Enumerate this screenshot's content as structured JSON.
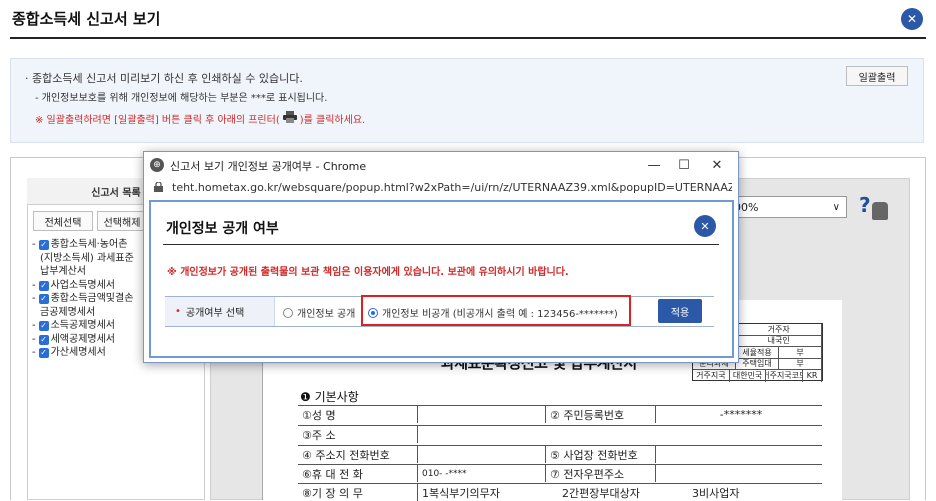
{
  "header": {
    "title": "종합소득세 신고서 보기",
    "close_label": "✕"
  },
  "info": {
    "line1": "· 종합소득세 신고서 미리보기 하신 후 인쇄하실 수 있습니다.",
    "line2": "- 개인정보보호를 위해 개인정보에 해당하는 부분은  ***로 표시됩니다.",
    "line3_before": "※ 일괄출력하려면 [일괄출력] 버튼 클릭 후 아래의 프린터(",
    "line3_after": ")를 클릭하세요.",
    "bulk_print_label": "일괄출력"
  },
  "left_pane": {
    "heading": "신고서 목록",
    "select_all_label": "전체선택",
    "deselect_label": "선택해제",
    "tree": [
      {
        "label": "종합소득세·농어촌",
        "checked": true
      },
      {
        "label": "(지방소득세) 과세표준",
        "checked": false,
        "indent": true
      },
      {
        "label": "납부계산서",
        "checked": false,
        "indent": true
      },
      {
        "label": "사업소득명세서",
        "checked": true
      },
      {
        "label": "종합소득금액및결손",
        "checked": true
      },
      {
        "label": "금공제명세서",
        "checked": false,
        "indent": true
      },
      {
        "label": "소득공제명세서",
        "checked": true
      },
      {
        "label": "세액공제명세서",
        "checked": true
      },
      {
        "label": "가산세명세서",
        "checked": true
      }
    ]
  },
  "viewer": {
    "zoom": "00%",
    "help_label": "?",
    "small_table": [
      [
        "",
        "거주자",
        ""
      ],
      [
        "",
        "내국인",
        ""
      ],
      [
        "",
        "세율적용",
        "부"
      ],
      [
        "문리과세",
        "주택임대",
        "부"
      ],
      [
        "거주지국",
        "대한민국",
        "거주지국코드",
        "KR"
      ]
    ],
    "heading": "과세표준확정신고 및 납부계산서",
    "section_title": "❶ 기본사항",
    "rows": [
      {
        "a": "①성    명",
        "b": "",
        "c": "② 주민등록번호",
        "d": "-*******"
      },
      {
        "a": "③주    소",
        "b": "",
        "c": "",
        "d": ""
      },
      {
        "a": "④ 주소지 전화번호",
        "b": "",
        "c": "⑤ 사업장 전화번호",
        "d": ""
      },
      {
        "a": "⑥휴 대 전 화",
        "b": "010-      -****",
        "c": "⑦ 전자우편주소",
        "d": ""
      },
      {
        "a": "⑧기 장 의 무",
        "b": "1복식부기의무자",
        "c": "2간편장부대상자",
        "d": "3비사업자"
      }
    ]
  },
  "popup": {
    "window_title": "신고서 보기 개인정보 공개여부 - Chrome",
    "url": "teht.hometax.go.kr/websquare/popup.html?w2xPath=/ui/rn/z/UTERNAAZ39.xml&popupID=UTERNAAZ3...",
    "dialog_title": "개인정보 공개 여부",
    "warning": "※ 개인정보가 공개된 출력물의 보관 책임은 이용자에게 있습니다. 보관에 유의하시기 바랍니다.",
    "option_label": "공개여부 선택",
    "radio_public": "개인정보 공개",
    "radio_private": "개인정보 비공개  (비공개시 출력 예 : 123456-*******)",
    "selected": "private",
    "apply_label": "적용"
  },
  "colors": {
    "accent": "#2b59a8",
    "warning": "#d12a2a",
    "highlight": "#e02020"
  }
}
